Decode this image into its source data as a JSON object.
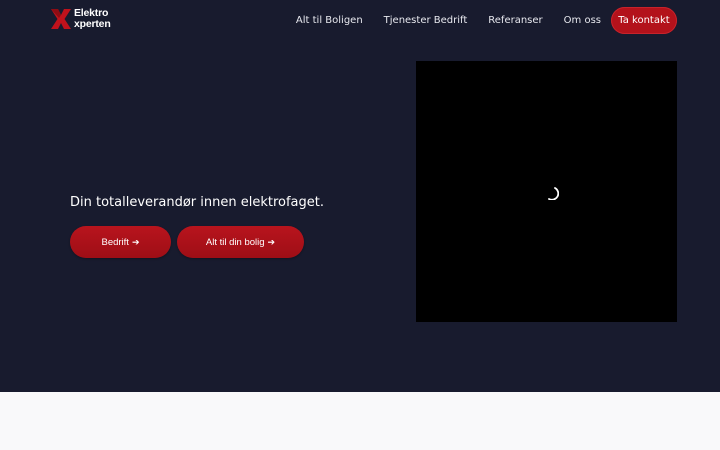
{
  "logo": {
    "line1": "Elektro",
    "line2": "xperten"
  },
  "nav": {
    "items": [
      {
        "label": "Alt til Boligen"
      },
      {
        "label": "Tjenester Bedrift"
      },
      {
        "label": "Referanser"
      },
      {
        "label": "Om oss"
      }
    ],
    "cta_label": "Ta kontakt"
  },
  "hero": {
    "tagline": "Din totalleverandør innen elektrofaget.",
    "buttons": [
      {
        "label": "Bedrift",
        "icon": "arrow-right-icon"
      },
      {
        "label": "Alt til din bolig",
        "icon": "arrow-right-icon"
      }
    ]
  },
  "media": {
    "state": "loading",
    "spinner_icon": "loading-spinner-icon"
  },
  "colors": {
    "hero_background": "#181b2e",
    "brand_red": "#b3121b",
    "video_background": "#000000",
    "page_background": "#f9f9fa"
  }
}
